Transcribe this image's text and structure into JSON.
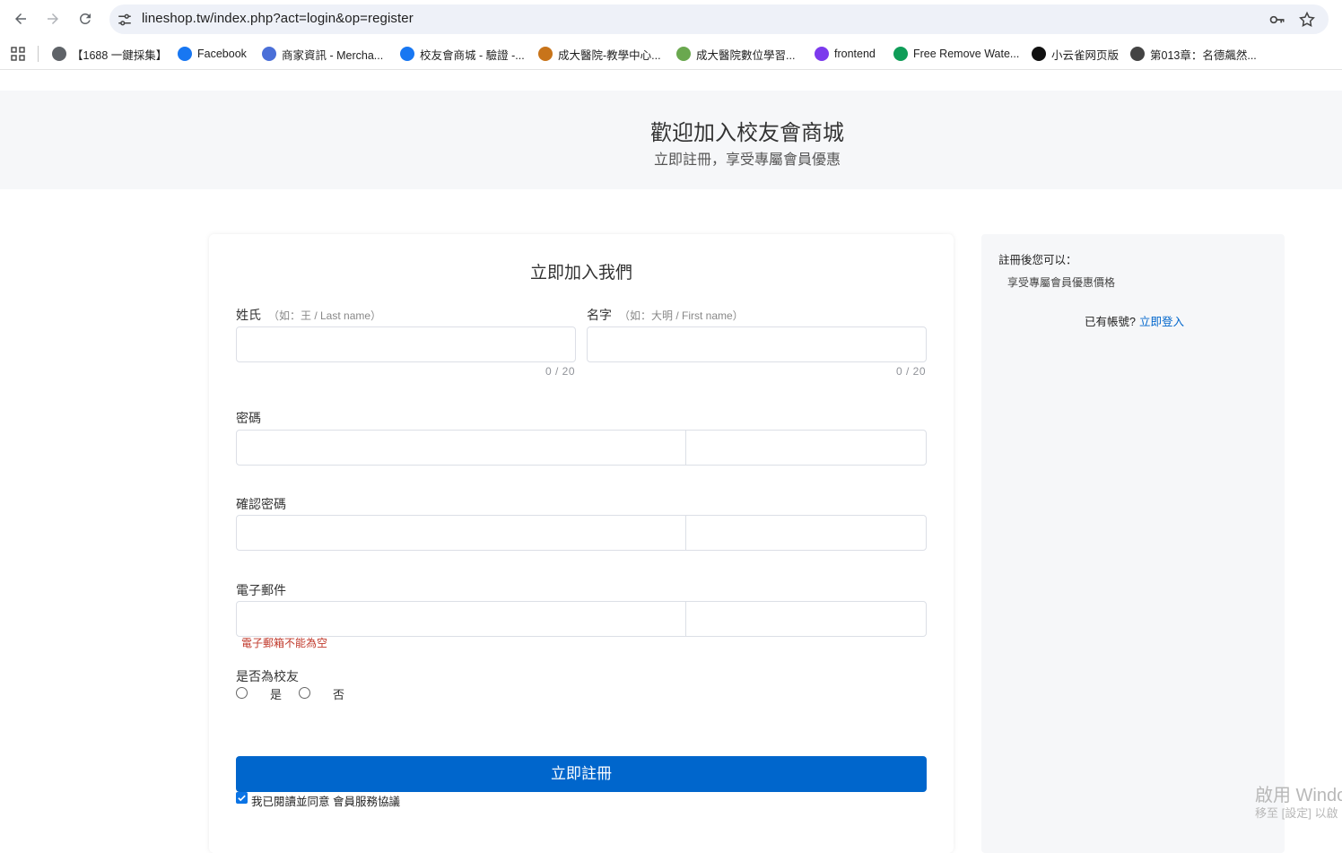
{
  "browser": {
    "url": "lineshop.tw/index.php?act=login&op=register",
    "bookmarks": [
      {
        "label": "【1688 一鍵採集】",
        "icon": "globe-icon",
        "color": "#5f6368"
      },
      {
        "label": "Facebook",
        "icon": "facebook-icon",
        "color": "#1877f2"
      },
      {
        "label": "商家資訊 - Mercha...",
        "icon": "merchant-icon",
        "color": "#4a6fd8"
      },
      {
        "label": "校友會商城 - 驗證 -...",
        "icon": "facebook-icon",
        "color": "#1877f2"
      },
      {
        "label": "成大醫院-教學中心...",
        "icon": "hospital-icon",
        "color": "#c8741a"
      },
      {
        "label": "成大醫院數位學習...",
        "icon": "hospital-icon",
        "color": "#6aa84f"
      },
      {
        "label": "frontend",
        "icon": "bolt-icon",
        "color": "#7c3aed"
      },
      {
        "label": "Free Remove Wate...",
        "icon": "remove-icon",
        "color": "#0f9d58"
      },
      {
        "label": "小云雀网页版",
        "icon": "bird-icon",
        "color": "#111111"
      },
      {
        "label": "第013章：名德飆然...",
        "icon": "tw-icon",
        "color": "#444444"
      }
    ]
  },
  "hero": {
    "title": "歡迎加入校友會商城",
    "subtitle": "立即註冊，享受專屬會員優惠"
  },
  "form": {
    "title": "立即加入我們",
    "last_name": {
      "label": "姓氏",
      "hint": "（如：王 / Last name）",
      "value": "",
      "counter": "0 / 20"
    },
    "first_name": {
      "label": "名字",
      "hint": "（如：大明 / First name）",
      "value": "",
      "counter": "0 / 20"
    },
    "password": {
      "label": "密碼",
      "value": ""
    },
    "confirm_password": {
      "label": "確認密碼",
      "value": ""
    },
    "email": {
      "label": "電子郵件",
      "value": "",
      "error": "電子郵箱不能為空"
    },
    "alumni": {
      "label": "是否為校友",
      "options": [
        "是",
        "否"
      ]
    },
    "submit_label": "立即註冊",
    "agree_label": "我已閱讀並同意 會員服務協議",
    "agree_checked": true
  },
  "sidebar": {
    "title": "註冊後您可以：",
    "benefit": "享受專屬會員優惠價格",
    "login_prompt": "已有帳號?",
    "login_link": "立即登入"
  },
  "watermark": {
    "line1": "啟用 Windo",
    "line2": "移至 [設定] 以啟"
  },
  "colors": {
    "accent": "#0066cc",
    "error": "#c0392b",
    "hero_bg": "#f6f7f9"
  }
}
